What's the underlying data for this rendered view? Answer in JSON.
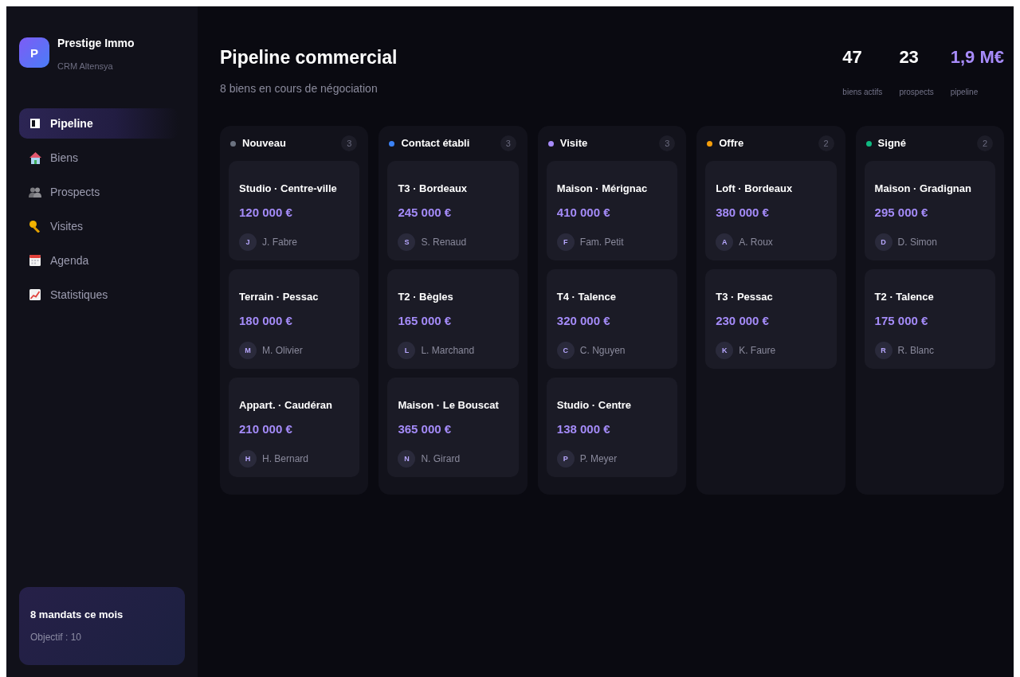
{
  "sidebar": {
    "brand": {
      "logo_letter": "P",
      "name": "Prestige Immo",
      "subtitle": "CRM Altensya"
    },
    "nav": [
      {
        "label": "Pipeline",
        "selected": true
      },
      {
        "label": "Biens",
        "selected": false
      },
      {
        "label": "Prospects",
        "selected": false
      },
      {
        "label": "Visites",
        "selected": false
      },
      {
        "label": "Agenda",
        "selected": false
      },
      {
        "label": "Statistiques",
        "selected": false
      }
    ],
    "goal_card": {
      "title": "8 mandats ce mois",
      "text": "Objectif : 10"
    }
  },
  "header": {
    "title": "Pipeline commercial",
    "subtitle": "8 biens en cours de négociation",
    "stats": [
      {
        "value": "47",
        "label": "biens actifs",
        "highlight": false
      },
      {
        "value": "23",
        "label": "prospects",
        "highlight": false
      },
      {
        "value": "1,9 M€",
        "label": "pipeline",
        "highlight": true
      }
    ]
  },
  "columns": [
    {
      "title": "Nouveau",
      "color": "#6b7280",
      "count": "3",
      "cards": [
        {
          "title": "Studio · Centre-ville",
          "price": "120 000 €",
          "initial": "J",
          "contact": "J. Fabre"
        },
        {
          "title": "Terrain · Pessac",
          "price": "180 000 €",
          "initial": "M",
          "contact": "M. Olivier"
        },
        {
          "title": "Appart. · Caudéran",
          "price": "210 000 €",
          "initial": "H",
          "contact": "H. Bernard"
        }
      ]
    },
    {
      "title": "Contact établi",
      "color": "#3b82f6",
      "count": "3",
      "cards": [
        {
          "title": "T3 · Bordeaux",
          "price": "245 000 €",
          "initial": "S",
          "contact": "S. Renaud"
        },
        {
          "title": "T2 · Bègles",
          "price": "165 000 €",
          "initial": "L",
          "contact": "L. Marchand"
        },
        {
          "title": "Maison · Le Bouscat",
          "price": "365 000 €",
          "initial": "N",
          "contact": "N. Girard"
        }
      ]
    },
    {
      "title": "Visite",
      "color": "#a78bfa",
      "count": "3",
      "cards": [
        {
          "title": "Maison · Mérignac",
          "price": "410 000 €",
          "initial": "F",
          "contact": "Fam. Petit"
        },
        {
          "title": "T4 · Talence",
          "price": "320 000 €",
          "initial": "C",
          "contact": "C. Nguyen"
        },
        {
          "title": "Studio · Centre",
          "price": "138 000 €",
          "initial": "P",
          "contact": "P. Meyer"
        }
      ]
    },
    {
      "title": "Offre",
      "color": "#f59e0b",
      "count": "2",
      "cards": [
        {
          "title": "Loft · Bordeaux",
          "price": "380 000 €",
          "initial": "A",
          "contact": "A. Roux"
        },
        {
          "title": "T3 · Pessac",
          "price": "230 000 €",
          "initial": "K",
          "contact": "K. Faure"
        }
      ]
    },
    {
      "title": "Signé",
      "color": "#10b981",
      "count": "2",
      "cards": [
        {
          "title": "Maison · Gradignan",
          "price": "295 000 €",
          "initial": "D",
          "contact": "D. Simon"
        },
        {
          "title": "T2 · Talence",
          "price": "175 000 €",
          "initial": "R",
          "contact": "R. Blanc"
        }
      ]
    }
  ]
}
